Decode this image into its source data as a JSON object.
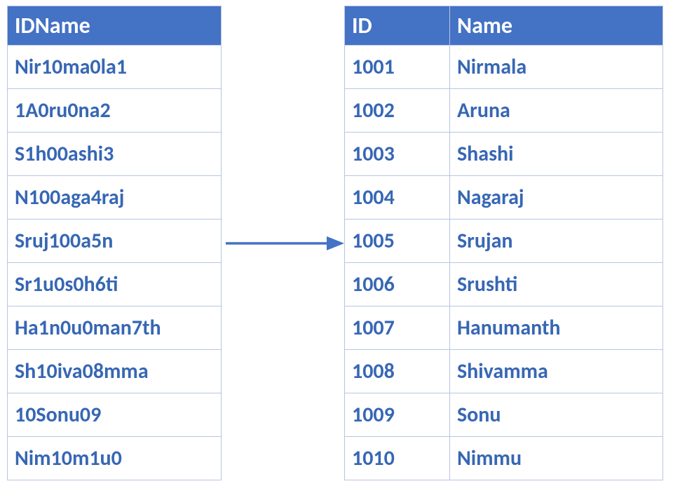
{
  "colors": {
    "header_bg": "#4472c4",
    "header_fg": "#ffffff",
    "cell_fg": "#3767b4",
    "border": "#b7c5e4",
    "arrow": "#4472c4"
  },
  "left_table": {
    "header": "IDName",
    "rows": [
      "Nir10ma0la1",
      "1A0ru0na2",
      "S1h00ashi3",
      "N100aga4raj",
      "Sruj100a5n",
      "Sr1u0s0h6ti",
      "Ha1n0u0man7th",
      "Sh10iva08mma",
      "10Sonu09",
      "Nim10m1u0"
    ]
  },
  "right_table": {
    "headers": {
      "col1": "ID",
      "col2": "Name"
    },
    "rows": [
      {
        "id": "1001",
        "name": "Nirmala"
      },
      {
        "id": "1002",
        "name": "Aruna"
      },
      {
        "id": "1003",
        "name": "Shashi"
      },
      {
        "id": "1004",
        "name": "Nagaraj"
      },
      {
        "id": "1005",
        "name": "Srujan"
      },
      {
        "id": "1006",
        "name": "Srushti"
      },
      {
        "id": "1007",
        "name": "Hanumanth"
      },
      {
        "id": "1008",
        "name": "Shivamma"
      },
      {
        "id": "1009",
        "name": "Sonu"
      },
      {
        "id": "1010",
        "name": "Nimmu"
      }
    ]
  }
}
